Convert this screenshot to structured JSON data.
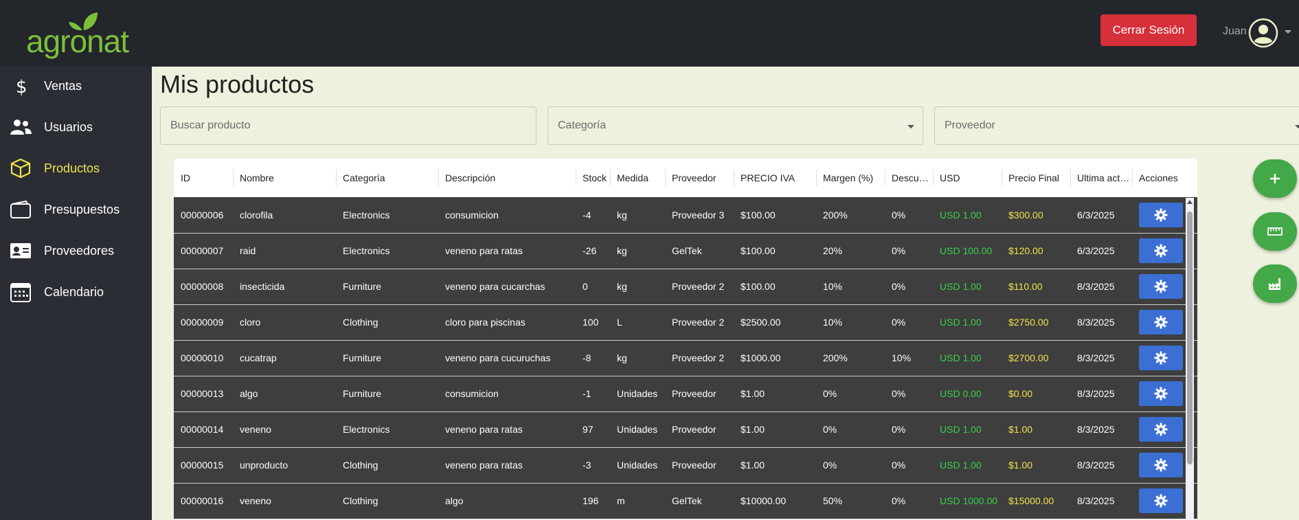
{
  "header": {
    "logout_label": "Cerrar Sesión",
    "user_name": "Juan"
  },
  "brand": {
    "logo_text": "agronat"
  },
  "sidebar": {
    "items": [
      {
        "label": "Ventas",
        "icon": "dollar-icon",
        "active": false
      },
      {
        "label": "Usuarios",
        "icon": "users-icon",
        "active": false
      },
      {
        "label": "Productos",
        "icon": "box-icon",
        "active": true
      },
      {
        "label": "Presupuestos",
        "icon": "wallet-icon",
        "active": false
      },
      {
        "label": "Proveedores",
        "icon": "id-card-icon",
        "active": false
      },
      {
        "label": "Calendario",
        "icon": "calendar-icon",
        "active": false
      }
    ]
  },
  "page": {
    "title": "Mis productos"
  },
  "filters": {
    "search_placeholder": "Buscar producto",
    "category_label": "Categoría",
    "supplier_label": "Proveedor"
  },
  "table": {
    "columns": [
      "ID",
      "Nombre",
      "Categoría",
      "Descripción",
      "Stock",
      "Medida",
      "Proveedor",
      "PRECIO IVA",
      "Margen (%)",
      "Descuento",
      "USD",
      "Precio Final",
      "Ultima actualización",
      "Acciones"
    ],
    "rows": [
      [
        "00000006",
        "clorofila",
        "Electronics",
        "consumicion",
        "-4",
        "kg",
        "Proveedor 3",
        "$100.00",
        "200%",
        "0%",
        "USD 1.00",
        "$300.00",
        "6/3/2025"
      ],
      [
        "00000007",
        "raid",
        "Electronics",
        "veneno para ratas",
        "-26",
        "kg",
        "GelTek",
        "$100.00",
        "20%",
        "0%",
        "USD 100.00",
        "$120.00",
        "6/3/2025"
      ],
      [
        "00000008",
        "insecticida",
        "Furniture",
        "veneno para cucarchas",
        "0",
        "kg",
        "Proveedor 2",
        "$100.00",
        "10%",
        "0%",
        "USD 1.00",
        "$110.00",
        "8/3/2025"
      ],
      [
        "00000009",
        "cloro",
        "Clothing",
        "cloro para piscinas",
        "100",
        "L",
        "Proveedor 2",
        "$2500.00",
        "10%",
        "0%",
        "USD 1.00",
        "$2750.00",
        "8/3/2025"
      ],
      [
        "00000010",
        "cucatrap",
        "Furniture",
        "veneno para cucuruchas",
        "-8",
        "kg",
        "Proveedor 2",
        "$1000.00",
        "200%",
        "10%",
        "USD 1.00",
        "$2700.00",
        "8/3/2025"
      ],
      [
        "00000013",
        "algo",
        "Furniture",
        "consumicion",
        "-1",
        "Unidades",
        "Proveedor",
        "$1.00",
        "0%",
        "0%",
        "USD 0.00",
        "$0.00",
        "8/3/2025"
      ],
      [
        "00000014",
        "veneno",
        "Electronics",
        "veneno para ratas",
        "97",
        "Unidades",
        "Proveedor",
        "$1.00",
        "0%",
        "0%",
        "USD 1.00",
        "$1.00",
        "8/3/2025"
      ],
      [
        "00000015",
        "unproducto",
        "Clothing",
        "veneno para ratas",
        "-3",
        "Unidades",
        "Proveedor",
        "$1.00",
        "0%",
        "0%",
        "USD 1.00",
        "$1.00",
        "8/3/2025"
      ],
      [
        "00000016",
        "veneno",
        "Clothing",
        "algo",
        "196",
        "m",
        "GelTek",
        "$10000.00",
        "50%",
        "0%",
        "USD 1000.00",
        "$15000.00",
        "8/3/2025"
      ]
    ]
  },
  "fabs": [
    {
      "icon": "plus-icon"
    },
    {
      "icon": "ruler-icon"
    },
    {
      "icon": "factory-icon"
    }
  ],
  "colors": {
    "header_bg": "#23262b",
    "sidebar_bg": "#2a2d33",
    "main_bg": "#eef1dd",
    "active_accent": "#f0e44a",
    "logout_red": "#d6303a",
    "usd_green": "#39d04a",
    "action_blue": "#3c6fd3",
    "fab_green": "#43a847"
  }
}
